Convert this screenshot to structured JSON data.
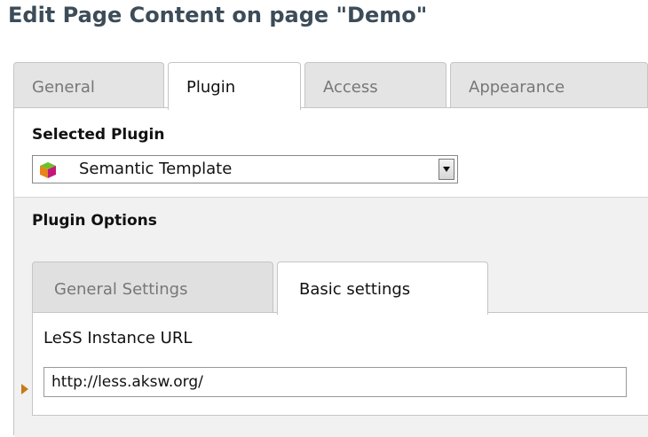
{
  "page": {
    "title": "Edit Page Content on page \"Demo\""
  },
  "tabs": [
    {
      "label": "General"
    },
    {
      "label": "Plugin"
    },
    {
      "label": "Access"
    },
    {
      "label": "Appearance"
    }
  ],
  "plugin": {
    "selected_label": "Selected Plugin",
    "selected_value": "Semantic Template",
    "icon": "colored-cube-icon",
    "options_label": "Plugin Options"
  },
  "inner_tabs": [
    {
      "label": "General Settings"
    },
    {
      "label": "Basic settings"
    }
  ],
  "basic_settings": {
    "instance_url_label": "LeSS Instance URL",
    "instance_url_value": "http://less.aksw.org/"
  },
  "colors": {
    "title": "#3c4c58",
    "tab_inactive": "#e4e4e4",
    "panel_grey": "#f1f1f1",
    "marker": "#c87a14"
  }
}
